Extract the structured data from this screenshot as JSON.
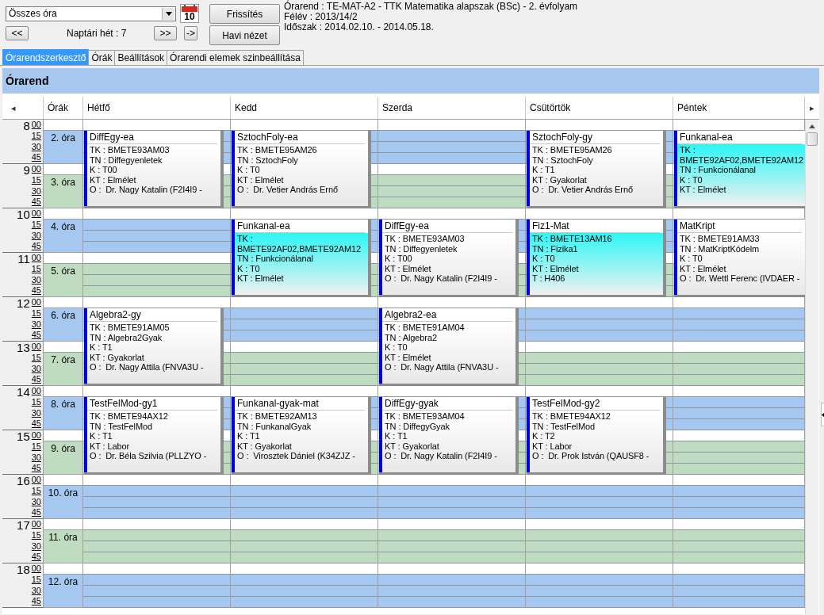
{
  "toolbar": {
    "view_select": {
      "value": "Összes óra"
    },
    "calendar_day": "10",
    "prev_button": "<<",
    "week_label": "Naptári hét : 7",
    "next_button": ">>",
    "go_button": "->",
    "refresh_button": "Frissítés",
    "month_view_button": "Havi nézet",
    "info": [
      "Órarend : TE-MAT-A2 - TTK Matematika alapszak (BSc) - 2. évfolyam",
      "Félév : 2013/14/2",
      "Időszak : 2014.02.10. - 2014.05.18."
    ]
  },
  "tabs": [
    {
      "label": "Órarendszerkesztő",
      "selected": true
    },
    {
      "label": "Órák",
      "selected": false
    },
    {
      "label": "Beállítások",
      "selected": false
    },
    {
      "label": "Órarendi elemek szinbeállítása",
      "selected": false
    }
  ],
  "panel": {
    "title": "Órarend",
    "scroll_left": "◂",
    "scroll_right": "▸",
    "columns": [
      "Órák",
      "Hétfő",
      "Kedd",
      "Szerda",
      "Csütörtök",
      "Péntek"
    ],
    "hours": [
      {
        "hour": "8",
        "minutes": [
          "00",
          "15",
          "30",
          "45"
        ],
        "period": "2. óra",
        "color": "#a6c8f0"
      },
      {
        "hour": "9",
        "minutes": [
          "00",
          "15",
          "30",
          "45"
        ],
        "period": "3. óra",
        "color": "#c0dcc0"
      },
      {
        "hour": "10",
        "minutes": [
          "00",
          "15",
          "30",
          "45"
        ],
        "period": "4. óra",
        "color": "#a6c8f0"
      },
      {
        "hour": "11",
        "minutes": [
          "00",
          "15",
          "30",
          "45"
        ],
        "period": "5. óra",
        "color": "#c0dcc0"
      },
      {
        "hour": "12",
        "minutes": [
          "00",
          "15",
          "30",
          "45"
        ],
        "period": "6. óra",
        "color": "#a6c8f0"
      },
      {
        "hour": "13",
        "minutes": [
          "00",
          "15",
          "30",
          "45"
        ],
        "period": "7. óra",
        "color": "#c0dcc0"
      },
      {
        "hour": "14",
        "minutes": [
          "00",
          "15",
          "30",
          "45"
        ],
        "period": "8. óra",
        "color": "#a6c8f0"
      },
      {
        "hour": "15",
        "minutes": [
          "00",
          "15",
          "30",
          "45"
        ],
        "period": "9. óra",
        "color": "#c0dcc0"
      },
      {
        "hour": "16",
        "minutes": [
          "00",
          "15",
          "30",
          "45"
        ],
        "period": "10. óra",
        "color": "#a6c8f0"
      },
      {
        "hour": "17",
        "minutes": [
          "00",
          "15",
          "30",
          "45"
        ],
        "period": "11. óra",
        "color": "#c0dcc0"
      },
      {
        "hour": "18",
        "minutes": [
          "00",
          "15",
          "30",
          "45"
        ],
        "period": "12. óra",
        "color": "#a6c8f0"
      }
    ],
    "days": [
      {
        "slots": [
          {
            "kind": "lesson",
            "title": "DiffEgy-ea",
            "highlighted": false,
            "lines": [
              "TK : BMETE93AM03",
              "TN : Diffegyenletek",
              "K : T00",
              "KT : Elmélet",
              "O :  Dr. Nagy Katalin (F2I4I9 -"
            ]
          },
          {
            "kind": "empty"
          },
          {
            "kind": "lesson",
            "title": "Algebra2-gy",
            "highlighted": false,
            "lines": [
              "TK : BMETE91AM05",
              "TN : Algebra2Gyak",
              "K : T1",
              "KT : Gyakorlat",
              "O :  Dr. Nagy Attila (FNVA3U -"
            ]
          },
          {
            "kind": "lesson",
            "title": "TestFelMod-gy1",
            "highlighted": false,
            "lines": [
              "TK : BMETE94AX12",
              "TN : TestFelMod",
              "K : T1",
              "KT : Labor",
              "O :  Dr. Béla Szilvia (PLLZYO -"
            ]
          }
        ]
      },
      {
        "slots": [
          {
            "kind": "lesson",
            "title": "SztochFoly-ea",
            "highlighted": false,
            "lines": [
              "TK : BMETE95AM26",
              "TN : SztochFoly",
              "K : T0",
              "KT : Elmélet",
              "O :  Dr. Vetier András Ernő"
            ]
          },
          {
            "kind": "lesson",
            "title": "Funkanal-ea",
            "highlighted": true,
            "lines": [
              "TK : BMETE92AF02,BMETE92AM12",
              "TN : Funkcionálanal",
              "K : T0",
              "KT : Elmélet"
            ]
          },
          {
            "kind": "empty"
          },
          {
            "kind": "lesson",
            "title": "Funkanal-gyak-mat",
            "highlighted": false,
            "lines": [
              "TK : BMETE92AM13",
              "TN : FunkanalGyak",
              "K : T1",
              "KT : Gyakorlat",
              "O :  Virosztek Dániel (K34ZJZ -"
            ]
          }
        ]
      },
      {
        "slots": [
          {
            "kind": "empty"
          },
          {
            "kind": "lesson",
            "title": "DiffEgy-ea",
            "highlighted": false,
            "lines": [
              "TK : BMETE93AM03",
              "TN : Diffegyenletek",
              "K : T00",
              "KT : Elmélet",
              "O :  Dr. Nagy Katalin (F2I4I9 -"
            ]
          },
          {
            "kind": "lesson",
            "title": "Algebra2-ea",
            "highlighted": false,
            "lines": [
              "TK : BMETE91AM04",
              "TN : Algebra2",
              "K : T0",
              "KT : Elmélet",
              "O :  Dr. Nagy Attila (FNVA3U -"
            ]
          },
          {
            "kind": "lesson",
            "title": "DiffEgy-gyak",
            "highlighted": false,
            "lines": [
              "TK : BMETE93AM04",
              "TN : DiffegyGyak",
              "K : T1",
              "KT : Gyakorlat",
              "O :  Dr. Nagy Katalin (F2I4I9 -"
            ]
          }
        ]
      },
      {
        "slots": [
          {
            "kind": "lesson",
            "title": "SztochFoly-gy",
            "highlighted": false,
            "lines": [
              "TK : BMETE95AM26",
              "TN : SztochFoly",
              "K : T1",
              "KT : Gyakorlat",
              "O :  Dr. Vetier András Ernő"
            ]
          },
          {
            "kind": "lesson",
            "title": "Fiz1-Mat",
            "highlighted": true,
            "lines": [
              "TK : BMETE13AM16",
              "TN : Fizika1",
              "K : T0",
              "KT : Elmélet",
              "T : H406"
            ]
          },
          {
            "kind": "empty"
          },
          {
            "kind": "lesson",
            "title": "TestFelMod-gy2",
            "highlighted": false,
            "lines": [
              "TK : BMETE94AX12",
              "TN : TestFelMod",
              "K : T2",
              "KT : Labor",
              "O :  Dr. Prok István (QAUSF8 -"
            ]
          }
        ]
      },
      {
        "slots": [
          {
            "kind": "lesson",
            "title": "Funkanal-ea",
            "highlighted": true,
            "lines": [
              "TK : BMETE92AF02,BMETE92AM12",
              "TN : Funkcionálanal",
              "K : T0",
              "KT : Elmélet"
            ]
          },
          {
            "kind": "lesson",
            "title": "MatKript",
            "highlighted": false,
            "lines": [
              "TK : BMETE91AM33",
              "TN : MatKriptKódelm",
              "K : T0",
              "KT : Elmélet",
              "O :  Dr. Wettl Ferenc (IVDAER -"
            ]
          }
        ]
      }
    ]
  }
}
